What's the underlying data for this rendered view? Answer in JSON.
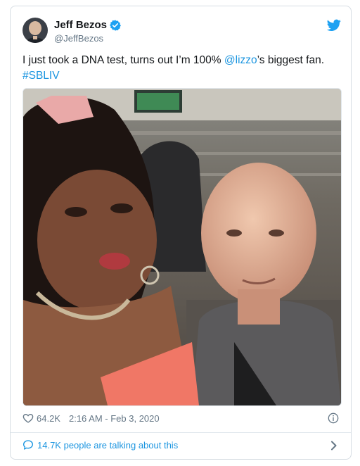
{
  "tweet": {
    "author_name": "Jeff Bezos",
    "author_handle": "@JeffBezos",
    "text_before": "I just took a DNA test, turns out I’m 100% ",
    "mention": "@lizzo",
    "text_after": "’s biggest fan.",
    "hashtag": "#SBLIV",
    "likes": "64.2K",
    "timestamp": "2:16 AM - Feb 3, 2020",
    "conversation": "14.7K people are talking about this"
  },
  "icons": {
    "verified": "verified-badge-icon",
    "brand": "bird-logo-icon",
    "like": "heart-icon",
    "info": "info-icon",
    "conversation": "speech-bubble-icon",
    "more": "chevron-right-icon"
  },
  "colors": {
    "link": "#1b95e0",
    "muted": "#657786",
    "border": "#e1e8ed"
  }
}
